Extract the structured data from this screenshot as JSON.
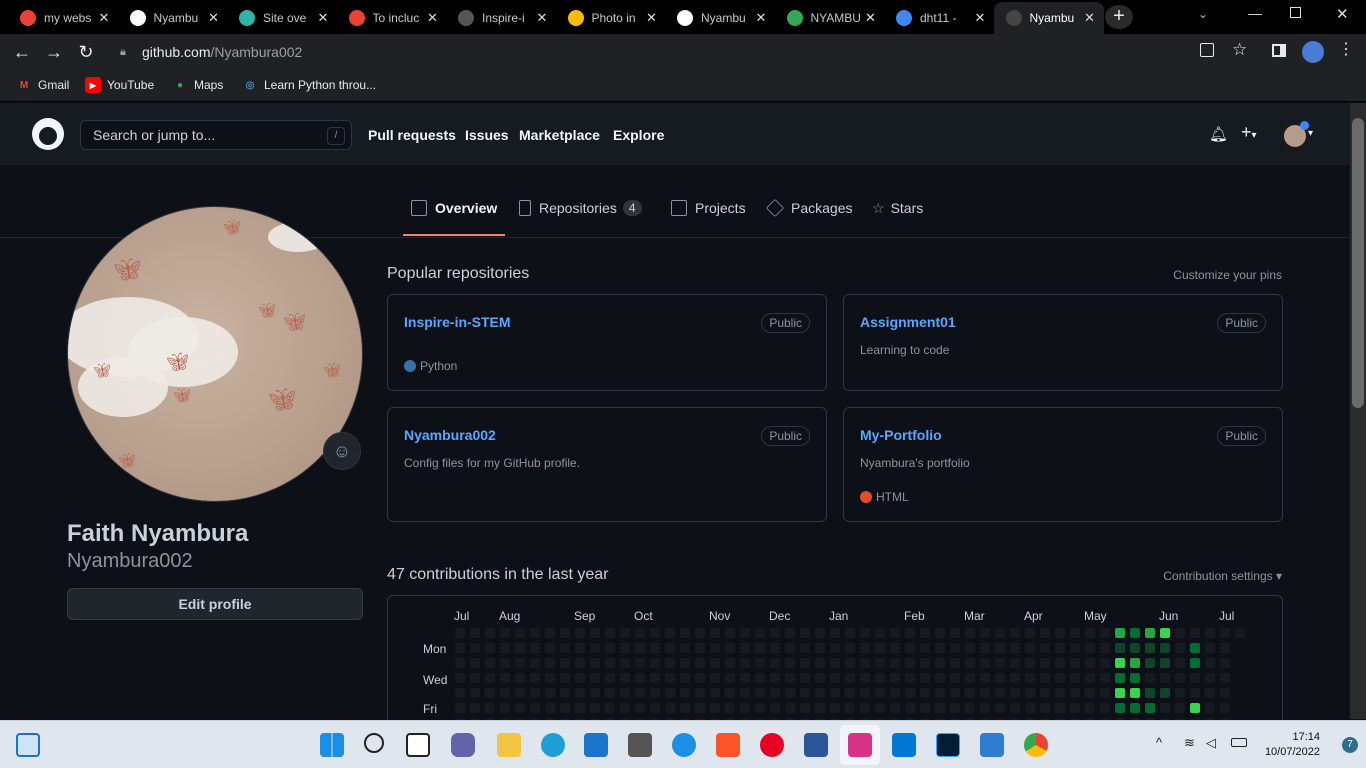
{
  "browser": {
    "tabs": [
      {
        "title": "my webs",
        "icon": "gmail-icon",
        "color": "#ea4335"
      },
      {
        "title": "Nyambu",
        "icon": "globe-icon",
        "color": "#ffffff"
      },
      {
        "title": "Site ove",
        "icon": "netlify-icon",
        "color": "#2fb5a8"
      },
      {
        "title": "To incluc",
        "icon": "gmail-icon",
        "color": "#ea4335"
      },
      {
        "title": "Inspire-i",
        "icon": "github-icon",
        "color": "#555555"
      },
      {
        "title": "Photo in",
        "icon": "pinwheel-icon",
        "color": "#fbbc04"
      },
      {
        "title": "Nyambu",
        "icon": "globe-icon",
        "color": "#ffffff"
      },
      {
        "title": "NYAMBU",
        "icon": "drive-icon",
        "color": "#34a853"
      },
      {
        "title": "dht11 -",
        "icon": "google-icon",
        "color": "#4285f4"
      },
      {
        "title": "Nyambu",
        "icon": "github-icon",
        "color": "#444444"
      }
    ],
    "url_host": "github.com",
    "url_path": "/Nyambura002",
    "bookmarks": [
      {
        "label": "Gmail",
        "icon": "gmail-icon",
        "color": "#ea4335"
      },
      {
        "label": "YouTube",
        "icon": "youtube-icon",
        "color": "#ff0000"
      },
      {
        "label": "Maps",
        "icon": "maps-icon",
        "color": "#34a853"
      },
      {
        "label": "Learn Python throu...",
        "icon": "python-icon",
        "color": "#4b8bbe"
      }
    ]
  },
  "github": {
    "search_placeholder": "Search or jump to...",
    "search_shortcut": "/",
    "nav": [
      "Pull requests",
      "Issues",
      "Marketplace",
      "Explore"
    ],
    "profile_tabs": [
      {
        "label": "Overview"
      },
      {
        "label": "Repositories",
        "count": "4"
      },
      {
        "label": "Projects"
      },
      {
        "label": "Packages"
      },
      {
        "label": "Stars"
      }
    ],
    "profile": {
      "full_name": "Faith Nyambura",
      "username": "Nyambura002",
      "edit_label": "Edit profile"
    },
    "popular_title": "Popular repositories",
    "customize_label": "Customize your pins",
    "repos": [
      {
        "name": "Inspire-in-STEM",
        "visibility": "Public",
        "description": "",
        "language": "Python",
        "lang_color": "#3572a5"
      },
      {
        "name": "Assignment01",
        "visibility": "Public",
        "description": "Learning to code",
        "language": "",
        "lang_color": ""
      },
      {
        "name": "Nyambura002",
        "visibility": "Public",
        "description": "Config files for my GitHub profile.",
        "language": "",
        "lang_color": ""
      },
      {
        "name": "My-Portfolio",
        "visibility": "Public",
        "description": "Nyambura's portfolio",
        "language": "HTML",
        "lang_color": "#e34c26"
      }
    ],
    "contributions_title": "47 contributions in the last year",
    "contribution_settings": "Contribution settings ▾",
    "months": [
      "Jul",
      "Aug",
      "Sep",
      "Oct",
      "Nov",
      "Dec",
      "Jan",
      "Feb",
      "Mar",
      "Apr",
      "May",
      "Jun",
      "Jul"
    ],
    "weekdays": [
      "Mon",
      "Wed",
      "Fri"
    ]
  },
  "taskbar": {
    "time": "17:14",
    "date": "10/07/2022",
    "notifications": "7"
  }
}
